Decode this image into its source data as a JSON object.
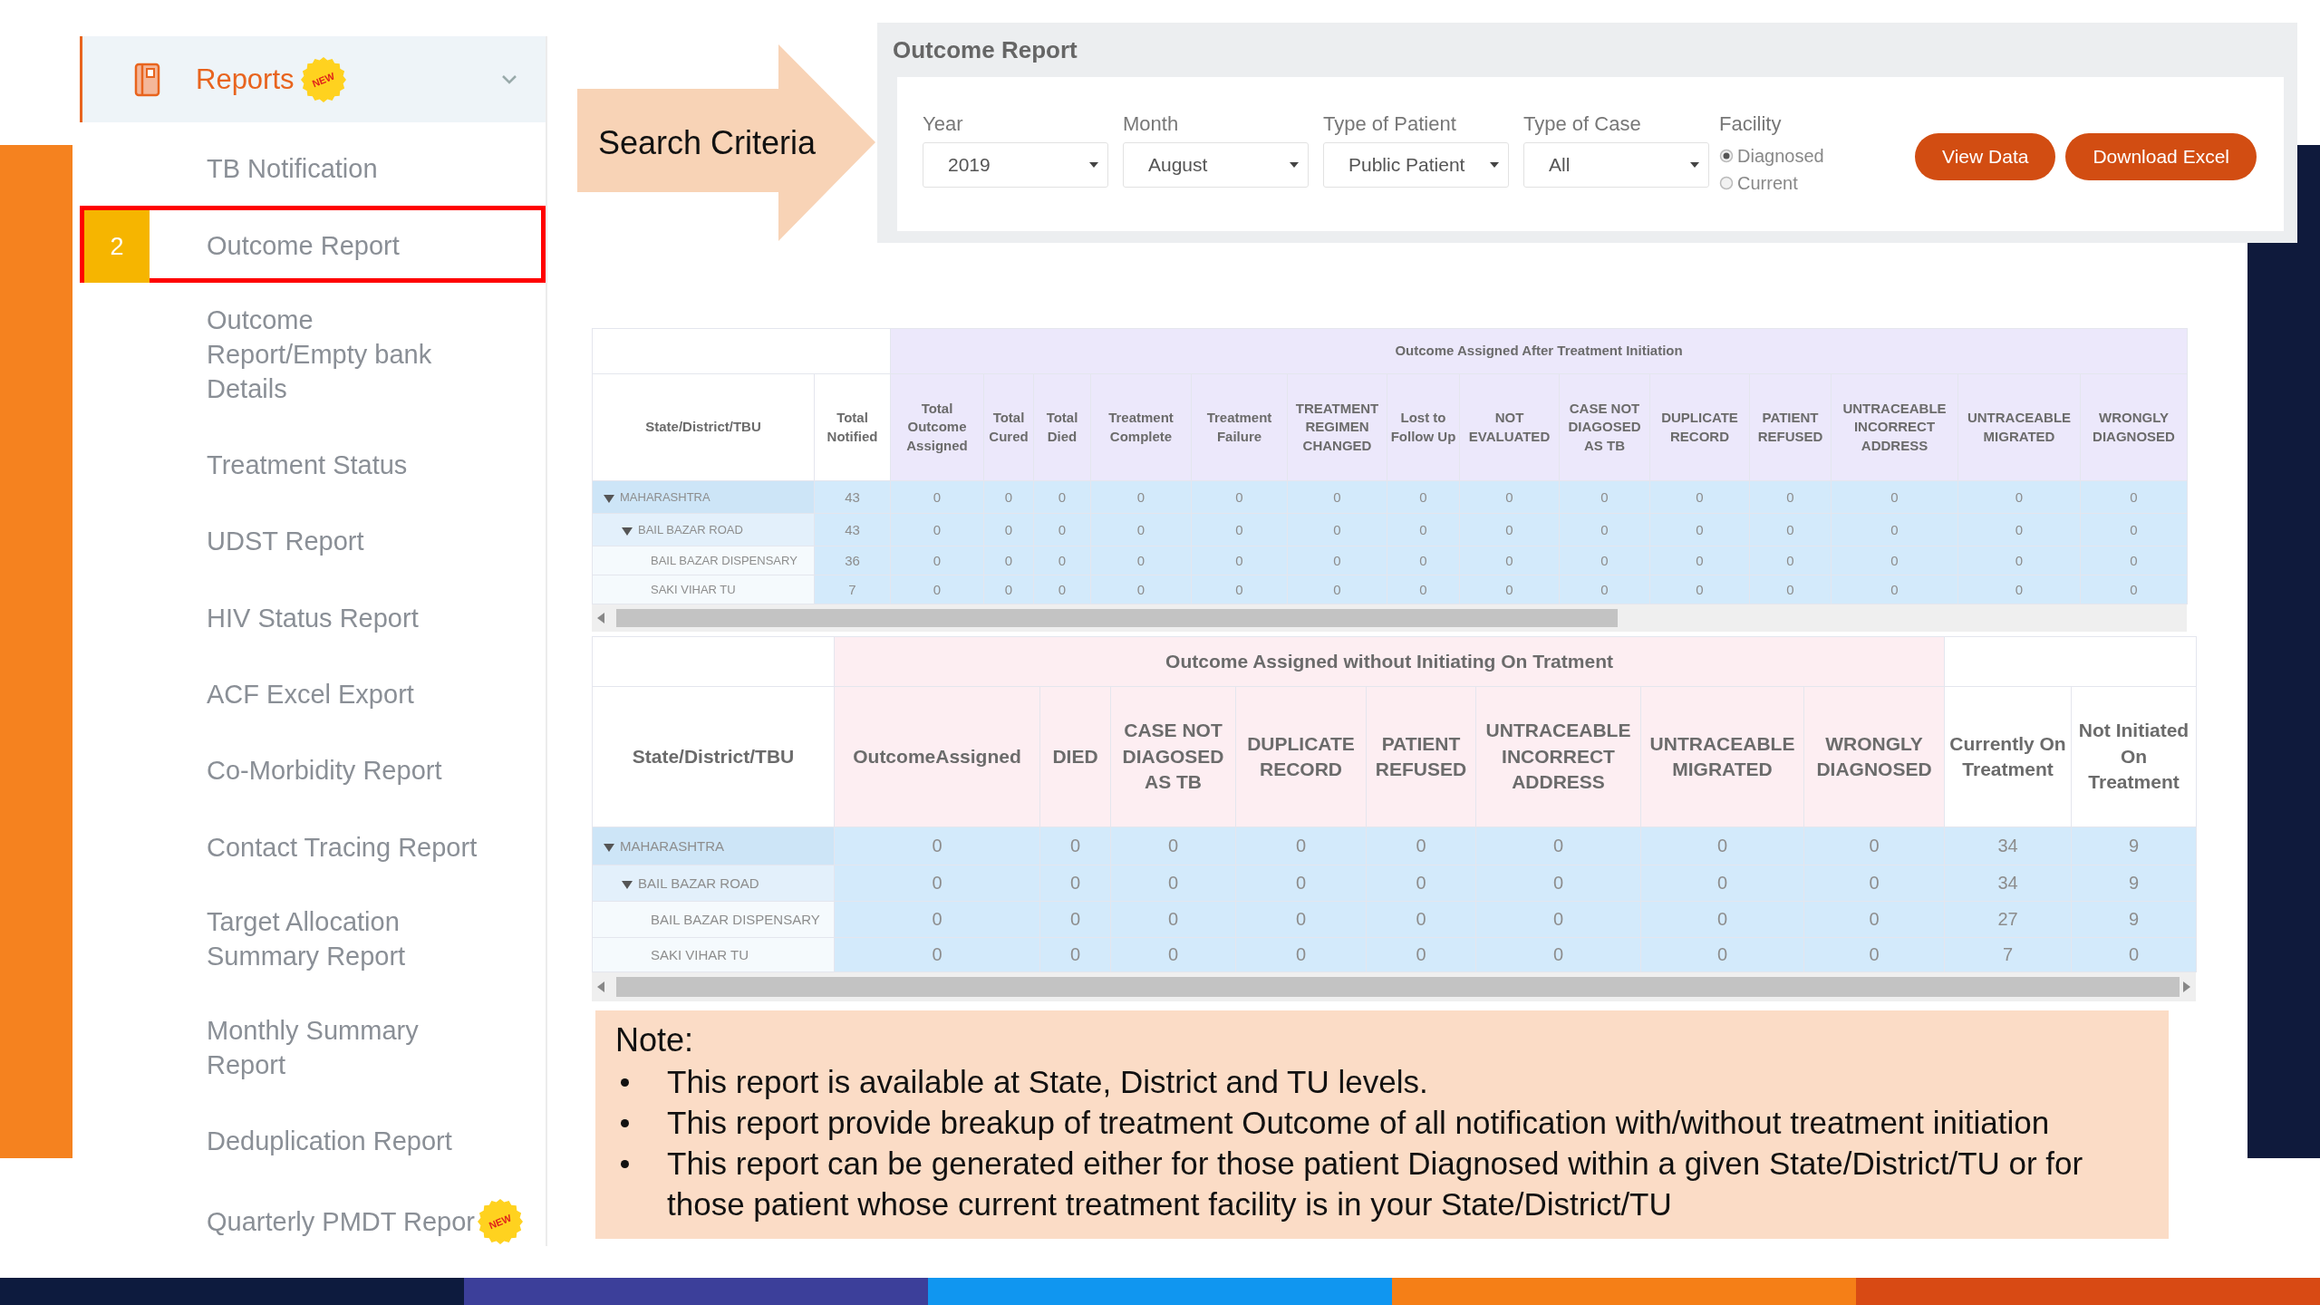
{
  "sidebar": {
    "header": {
      "label": "Reports",
      "badge": "NEW",
      "expanded": true
    },
    "items": [
      {
        "label": "TB Notification",
        "selected": false
      },
      {
        "label": "Outcome Report",
        "selected": true,
        "step": "2"
      },
      {
        "label": "Outcome Report/Empty bank Details",
        "selected": false
      },
      {
        "label": "Treatment Status",
        "selected": false
      },
      {
        "label": "UDST Report",
        "selected": false
      },
      {
        "label": "HIV Status Report",
        "selected": false
      },
      {
        "label": "ACF Excel Export",
        "selected": false
      },
      {
        "label": "Co-Morbidity Report",
        "selected": false
      },
      {
        "label": "Contact Tracing Report",
        "selected": false
      },
      {
        "label": "Target Allocation Summary Report",
        "selected": false
      },
      {
        "label": "Monthly Summary Report",
        "selected": false
      },
      {
        "label": "Deduplication Report",
        "selected": false
      },
      {
        "label": "Quarterly PMDT Repor",
        "selected": false,
        "badge": "NEW"
      }
    ]
  },
  "callout": {
    "label": "Search Criteria"
  },
  "search_panel": {
    "title": "Outcome Report",
    "filters": [
      {
        "label": "Year",
        "value": "2019"
      },
      {
        "label": "Month",
        "value": "August"
      },
      {
        "label": "Type of Patient",
        "value": "Public Patient"
      },
      {
        "label": "Type of Case",
        "value": "All"
      }
    ],
    "facility": {
      "label": "Facility",
      "options": [
        {
          "label": "Diagnosed",
          "selected": true
        },
        {
          "label": "Current",
          "selected": false
        }
      ]
    },
    "buttons": [
      "View Data",
      "Download Excel"
    ]
  },
  "tables": [
    {
      "group_header": "Outcome Assigned After Treatment Initiation",
      "columns": [
        {
          "label": "State/District/TBU",
          "grouped": false
        },
        {
          "label": "Total Notified",
          "grouped": false
        },
        {
          "label": "Total Outcome Assigned",
          "grouped": true
        },
        {
          "label": "Total Cured",
          "grouped": true
        },
        {
          "label": "Total Died",
          "grouped": true
        },
        {
          "label": "Treatment Complete",
          "grouped": true
        },
        {
          "label": "Treatment Failure",
          "grouped": true
        },
        {
          "label": "TREATMENT REGIMEN CHANGED",
          "grouped": true
        },
        {
          "label": "Lost to Follow Up",
          "grouped": true
        },
        {
          "label": "NOT EVALUATED",
          "grouped": true
        },
        {
          "label": "CASE NOT DIAGOSED AS TB",
          "grouped": true
        },
        {
          "label": "DUPLICATE RECORD",
          "grouped": true
        },
        {
          "label": "PATIENT REFUSED",
          "grouped": true
        },
        {
          "label": "UNTRACEABLE INCORRECT ADDRESS",
          "grouped": true
        },
        {
          "label": "UNTRACEABLE MIGRATED",
          "grouped": true
        },
        {
          "label": "WRONGLY DIAGNOSED",
          "grouped": true
        }
      ],
      "rows": [
        {
          "name": "MAHARASHTRA",
          "expanded": true,
          "values": [
            "43",
            "0",
            "0",
            "0",
            "0",
            "0",
            "0",
            "0",
            "0",
            "0",
            "0",
            "0",
            "0",
            "0",
            "0"
          ],
          "children": [
            {
              "name": "BAIL BAZAR ROAD",
              "expanded": true,
              "values": [
                "43",
                "0",
                "0",
                "0",
                "0",
                "0",
                "0",
                "0",
                "0",
                "0",
                "0",
                "0",
                "0",
                "0",
                "0"
              ],
              "children": [
                {
                  "name": "BAIL BAZAR DISPENSARY",
                  "values": [
                    "36",
                    "0",
                    "0",
                    "0",
                    "0",
                    "0",
                    "0",
                    "0",
                    "0",
                    "0",
                    "0",
                    "0",
                    "0",
                    "0",
                    "0"
                  ]
                },
                {
                  "name": "SAKI VIHAR TU",
                  "values": [
                    "7",
                    "0",
                    "0",
                    "0",
                    "0",
                    "0",
                    "0",
                    "0",
                    "0",
                    "0",
                    "0",
                    "0",
                    "0",
                    "0",
                    "0"
                  ]
                }
              ]
            }
          ]
        }
      ]
    },
    {
      "group_header": "Outcome Assigned without Initiating On Tratment",
      "columns": [
        {
          "label": "State/District/TBU",
          "grouped": false
        },
        {
          "label": "OutcomeAssigned",
          "grouped": true
        },
        {
          "label": "DIED",
          "grouped": true
        },
        {
          "label": "CASE NOT DIAGOSED AS TB",
          "grouped": true
        },
        {
          "label": "DUPLICATE RECORD",
          "grouped": true
        },
        {
          "label": "PATIENT REFUSED",
          "grouped": true
        },
        {
          "label": "UNTRACEABLE INCORRECT ADDRESS",
          "grouped": true
        },
        {
          "label": "UNTRACEABLE MIGRATED",
          "grouped": true
        },
        {
          "label": "WRONGLY DIAGNOSED",
          "grouped": true
        },
        {
          "label": "Currently On Treatment",
          "grouped": false
        },
        {
          "label": "Not Initiated On Treatment",
          "grouped": false
        }
      ],
      "rows": [
        {
          "name": "MAHARASHTRA",
          "expanded": true,
          "values": [
            "0",
            "0",
            "0",
            "0",
            "0",
            "0",
            "0",
            "0",
            "34",
            "9"
          ],
          "children": [
            {
              "name": "BAIL BAZAR ROAD",
              "expanded": true,
              "values": [
                "0",
                "0",
                "0",
                "0",
                "0",
                "0",
                "0",
                "0",
                "34",
                "9"
              ],
              "children": [
                {
                  "name": "BAIL BAZAR DISPENSARY",
                  "values": [
                    "0",
                    "0",
                    "0",
                    "0",
                    "0",
                    "0",
                    "0",
                    "0",
                    "27",
                    "9"
                  ]
                },
                {
                  "name": "SAKI VIHAR TU",
                  "values": [
                    "0",
                    "0",
                    "0",
                    "0",
                    "0",
                    "0",
                    "0",
                    "0",
                    "7",
                    "0"
                  ]
                }
              ]
            }
          ]
        }
      ]
    }
  ],
  "note": {
    "title": "Note:",
    "items": [
      "This report is available at State, District and TU levels.",
      "This report provide breakup of treatment Outcome of all notification with/without treatment initiation",
      "This report can be generated either for those patient Diagnosed within a given State/District/TU or for those patient whose current treatment facility is in your State/District/TU"
    ]
  }
}
